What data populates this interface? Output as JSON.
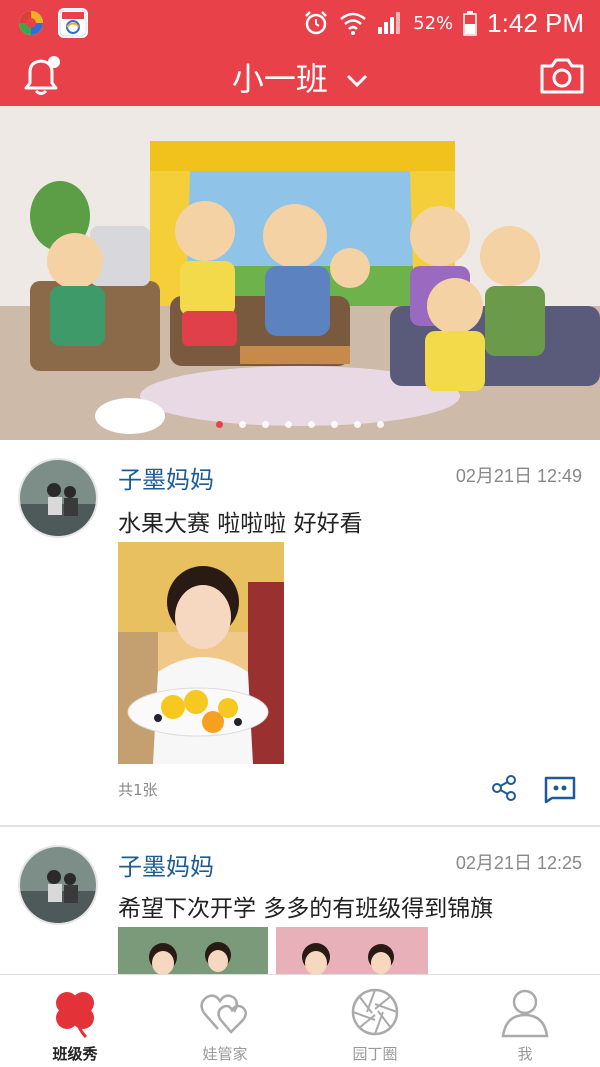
{
  "status_bar": {
    "battery": "52%",
    "time": "1:42 PM"
  },
  "header": {
    "title": "小一班"
  },
  "banner": {
    "dot_count": 8,
    "active_index": 0
  },
  "posts": [
    {
      "author": "子墨妈妈",
      "date": "02月21日 12:49",
      "text": "水果大赛 啦啦啦 好好看",
      "count": "共1张"
    },
    {
      "author": "子墨妈妈",
      "date": "02月21日 12:25",
      "text": "希望下次开学 多多的有班级得到锦旗"
    }
  ],
  "tabs": [
    {
      "label": "班级秀",
      "icon": "clover-icon",
      "active": true
    },
    {
      "label": "娃管家",
      "icon": "hearts-icon",
      "active": false
    },
    {
      "label": "园丁圈",
      "icon": "aperture-icon",
      "active": false
    },
    {
      "label": "我",
      "icon": "person-icon",
      "active": false
    }
  ],
  "colors": {
    "brand": "#e8414a",
    "author": "#1d5b98"
  }
}
